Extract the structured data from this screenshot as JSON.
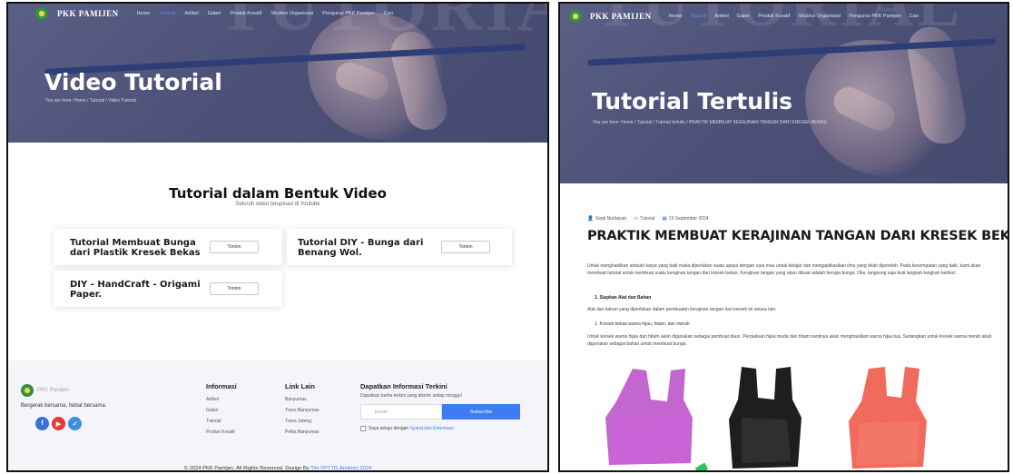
{
  "left": {
    "nav": {
      "brand": "PKK PAMIJEN",
      "items": [
        "Home",
        "Tutorial",
        "Artikel",
        "Galeri",
        "Produk Kreatif",
        "Struktur Organisasi",
        "Pengurus PKK Pamijen",
        "Cari"
      ]
    },
    "hero": {
      "title": "Video Tutorial",
      "breadcrumb": "You are here: Home  /  Tutorial  /  Video Tutorial",
      "bg_word": "TUTORIAL"
    },
    "section": {
      "title": "Tutorial dalam Bentuk Video",
      "subtitle": "Seluruh video terupload di Youtube"
    },
    "cards": [
      {
        "title_line1": "Tutorial Membuat Bunga",
        "title_line2": "dari Plastik Kresek Bekas",
        "button": "Tonton"
      },
      {
        "title_line1": "Tutorial DIY - Bunga dari",
        "title_line2": "Benang Wol.",
        "button": "Tonton"
      },
      {
        "title_line1": "DIY - HandCraft - Origami",
        "title_line2": "Paper.",
        "button": "Tonton"
      }
    ],
    "footer": {
      "brand": "PKK Pamijen",
      "tagline": "Bergerak bersama, hebat bersama.",
      "social": [
        "f",
        "yt",
        "tw"
      ],
      "info": {
        "heading": "Informasi",
        "links": [
          "Artikel",
          "Galeri",
          "Tutorial",
          "Produk Kreatif"
        ]
      },
      "linklain": {
        "heading": "Link Lain",
        "links": [
          "Banyumas",
          "Trans Banyumas",
          "Trans Jateng",
          "Pelita Banyumas"
        ]
      },
      "newsletter": {
        "heading": "Dapatkan Informasi Terkini",
        "desc": "Dapatkan berita terkini yang dikirim setiap minggu!",
        "email_placeholder": "Email",
        "subscribe": "Subscribe",
        "agree_prefix": "Saya setuju dengan ",
        "agree_link": "Syarat dan Ketentuan"
      },
      "copyright_prefix": "© 2024 PKK Pamijen, All Rights Reserved. Design By ",
      "copyright_link": "Tim PPTTG Amikom 2024"
    }
  },
  "right": {
    "nav": {
      "brand": "PKK PAMIJEN",
      "items": [
        "Home",
        "Tutorial",
        "Artikel",
        "Galeri",
        "Produk Kreatif",
        "Struktur Organisasi",
        "Pengurus PKK Pamijen",
        "Cari"
      ]
    },
    "hero": {
      "title": "Tutorial Tertulis",
      "breadcrumb": "You are here: Home  /  Tutorial  /  Tutorial tertulis  /  PRAKTIK MEMBUAT KERAJINAN TANGAN DARI KRESEK BEKAS",
      "bg_word": "TUTORIAL"
    },
    "article": {
      "author": "Septi Nurfaiyati",
      "category": "Tutorial",
      "date": "19 September 2024",
      "title": "PRAKTIK MEMBUAT KERAJINAN TANGAN DARI KRESEK BEKAS",
      "intro": "Untuk menghasilkan sebuah karya yang baik maka diperlukan suatu upaya dengan cara mau untuk belajar dan mengaplikasikan ilmu yang telah diperoleh. Pada kesempatan yang baik, kami akan membuat tutorial untuk membuat suatu kerajinan tangan dari kresek bekas. Kerajinan tangan yang akan dibuat adalah berupa bunga. Oke, langsung saja ikuti langkah-langkah berikut:",
      "step1": "1.  Siapkan Alat dan Bahan",
      "step1_desc": "Alat dan bahan yang diperlukan dalam pembuatan kerajinan tangan dari kresek ini antara lain:",
      "item1": "1.  Kresek bekas warna hijau, hitam, dan merah",
      "para2": "Untuk kresek warna hijau dan hitam akan digunakan sebagai pembuat daun. Perpaduan hijau muda dan hitam nantinya akan menghasilkan warna hijau tua. Sedangkan untuk kresek warna merah akan digunakan sebagai bahan untuk membuat bunga."
    }
  }
}
